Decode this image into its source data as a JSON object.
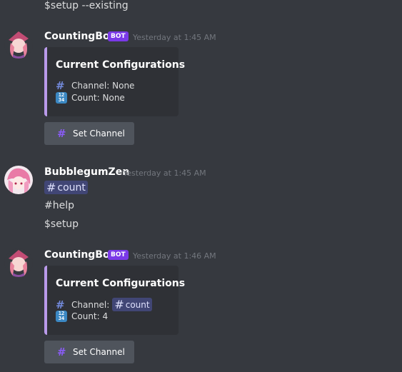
{
  "top_message": "$setup --existing",
  "messages": [
    {
      "username": "CountingBot",
      "bot_tag": "BOT",
      "timestamp": "Yesterday at 1:45 AM",
      "embed": {
        "title": "Current Configurations",
        "channel_label": "Channel: None",
        "count_label": "Count: None"
      },
      "button_label": "Set Channel"
    },
    {
      "username": "BubblegumZen",
      "timestamp": "Yesterday at 1:45 AM",
      "lines": {
        "mention": "count",
        "line2": "#help",
        "line3": "$setup"
      }
    },
    {
      "username": "CountingBot",
      "bot_tag": "BOT",
      "timestamp": "Yesterday at 1:46 AM",
      "embed": {
        "title": "Current Configurations",
        "channel_prefix": "Channel:",
        "channel_mention": "count",
        "count_label": "Count: 4"
      },
      "button_label": "Set Channel"
    }
  ],
  "icons": {
    "hash": "#",
    "numbers": "1234"
  },
  "colors": {
    "background": "#36393f",
    "embed_bg": "#2f3136",
    "embed_border": "#b99aea",
    "bot_tag": "#7a39e8",
    "button": "#4f545c",
    "mention_bg": "#414675"
  }
}
